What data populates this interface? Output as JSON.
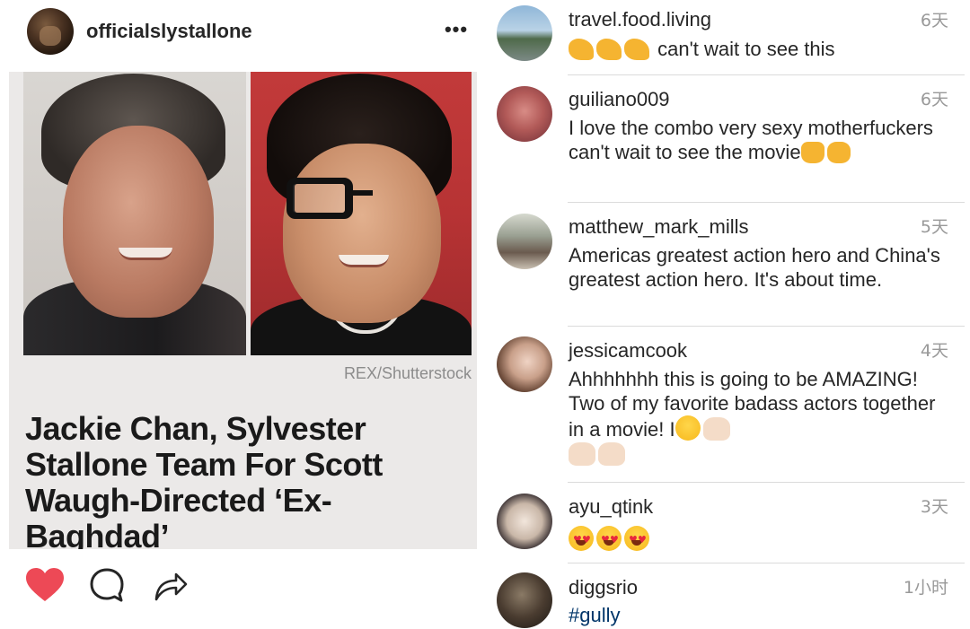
{
  "post": {
    "username": "officialslystallone",
    "more_label": "•••",
    "photo_credit": "REX/Shutterstock",
    "headline": "Jackie Chan, Sylvester Stallone Team For Scott Waugh-Directed ‘Ex-Baghdad’",
    "actions": {
      "like_icon": "heart-icon",
      "comment_icon": "comment-icon",
      "share_icon": "share-icon",
      "liked": true,
      "like_color": "#ed4956"
    }
  },
  "comments": [
    {
      "username": "travel.food.living",
      "time": "6天",
      "text": "can't wait to see this",
      "emojis": [
        "flexed-biceps",
        "flexed-biceps",
        "flexed-biceps"
      ]
    },
    {
      "username": "guiliano009",
      "time": "6天",
      "text": "I love the combo very sexy motherfuckers can't wait to see the movie",
      "emojis": [
        "thumbs-up",
        "fist"
      ]
    },
    {
      "username": "matthew_mark_mills",
      "time": "5天",
      "text": "Americas greatest action hero and China's greatest action hero.  It's about time."
    },
    {
      "username": "jessicamcook",
      "time": "4天",
      "text": "Ahhhhhhh this is going to be AMAZING! Two of my favorite badass actors together in a movie! I",
      "emojis": [
        "smiling-face",
        "raising-hands",
        "raising-hands",
        "raising-hands"
      ]
    },
    {
      "username": "ayu_qtink",
      "time": "3天",
      "emojis": [
        "heart-eyes",
        "heart-eyes",
        "heart-eyes"
      ]
    },
    {
      "username": "diggsrio",
      "time": "1小时",
      "text": "#gully"
    }
  ]
}
